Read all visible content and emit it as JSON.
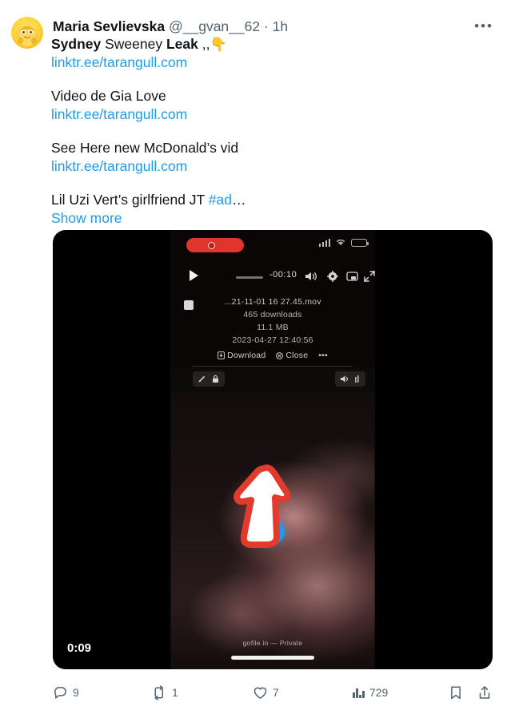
{
  "post": {
    "author": {
      "display_name": "Maria Sevlievska",
      "handle": "@__gvan__62",
      "separator": "·",
      "timestamp": "1h",
      "avatar_icon": "yellow-cartoon-avatar"
    },
    "more_menu_label": "•••",
    "text_lines": [
      {
        "type": "mixed",
        "parts": [
          {
            "text": "Sydney",
            "bold": true
          },
          {
            "text": " Sweeney ",
            "bold": false
          },
          {
            "text": "Leak",
            "bold": true
          },
          {
            "text": " ,,",
            "bold": false
          },
          {
            "text": "👇",
            "emoji": true
          }
        ]
      },
      {
        "type": "link",
        "text": "linktr.ee/tarangull.com"
      },
      {
        "type": "spacer"
      },
      {
        "type": "text",
        "text": "Video de Gia Love"
      },
      {
        "type": "link",
        "text": "linktr.ee/tarangull.com"
      },
      {
        "type": "spacer"
      },
      {
        "type": "text",
        "text": "See Here new McDonald’s vid"
      },
      {
        "type": "link",
        "text": "linktr.ee/tarangull.com"
      },
      {
        "type": "spacer"
      },
      {
        "type": "mixed",
        "parts": [
          {
            "text": "Lil Uzi Vert’s girlfriend JT ",
            "bold": false
          },
          {
            "text": "#ad",
            "link": true
          },
          {
            "text": "…",
            "bold": false
          }
        ]
      },
      {
        "type": "showmore",
        "text": "Show more"
      }
    ],
    "media": {
      "duration_badge": "0:09",
      "play_button_label": "play",
      "inner_capture": {
        "recording_pill": "screen-recording",
        "player": {
          "time_remaining": "-00:10",
          "controls": [
            "play",
            "scrubber",
            "volume",
            "settings",
            "picture-in-picture",
            "fullscreen"
          ]
        },
        "file": {
          "name": "...21-11-01 16 27.45.mov",
          "downloads": "465 downloads",
          "size": "11.1 MB",
          "date": "2023-04-27 12:40:56",
          "download_label": "Download",
          "close_label": "Close",
          "overflow_label": "•••"
        },
        "watermark": "gofile.io — Private"
      },
      "annotation": {
        "type": "red-arrow",
        "color": "#e23b2e"
      }
    },
    "actions": {
      "reply": {
        "icon": "reply-icon",
        "count": "9"
      },
      "retweet": {
        "icon": "retweet-icon",
        "count": "1"
      },
      "like": {
        "icon": "heart-icon",
        "count": "7"
      },
      "views": {
        "icon": "views-bar-icon",
        "count": "729"
      },
      "bookmark": {
        "icon": "bookmark-icon",
        "count": ""
      },
      "share": {
        "icon": "share-icon",
        "count": ""
      }
    }
  },
  "colors": {
    "link": "#1d9bf0",
    "text": "#0f1419",
    "muted": "#536471",
    "annotation_red": "#e23b2e",
    "recording_red": "#e0342c"
  }
}
